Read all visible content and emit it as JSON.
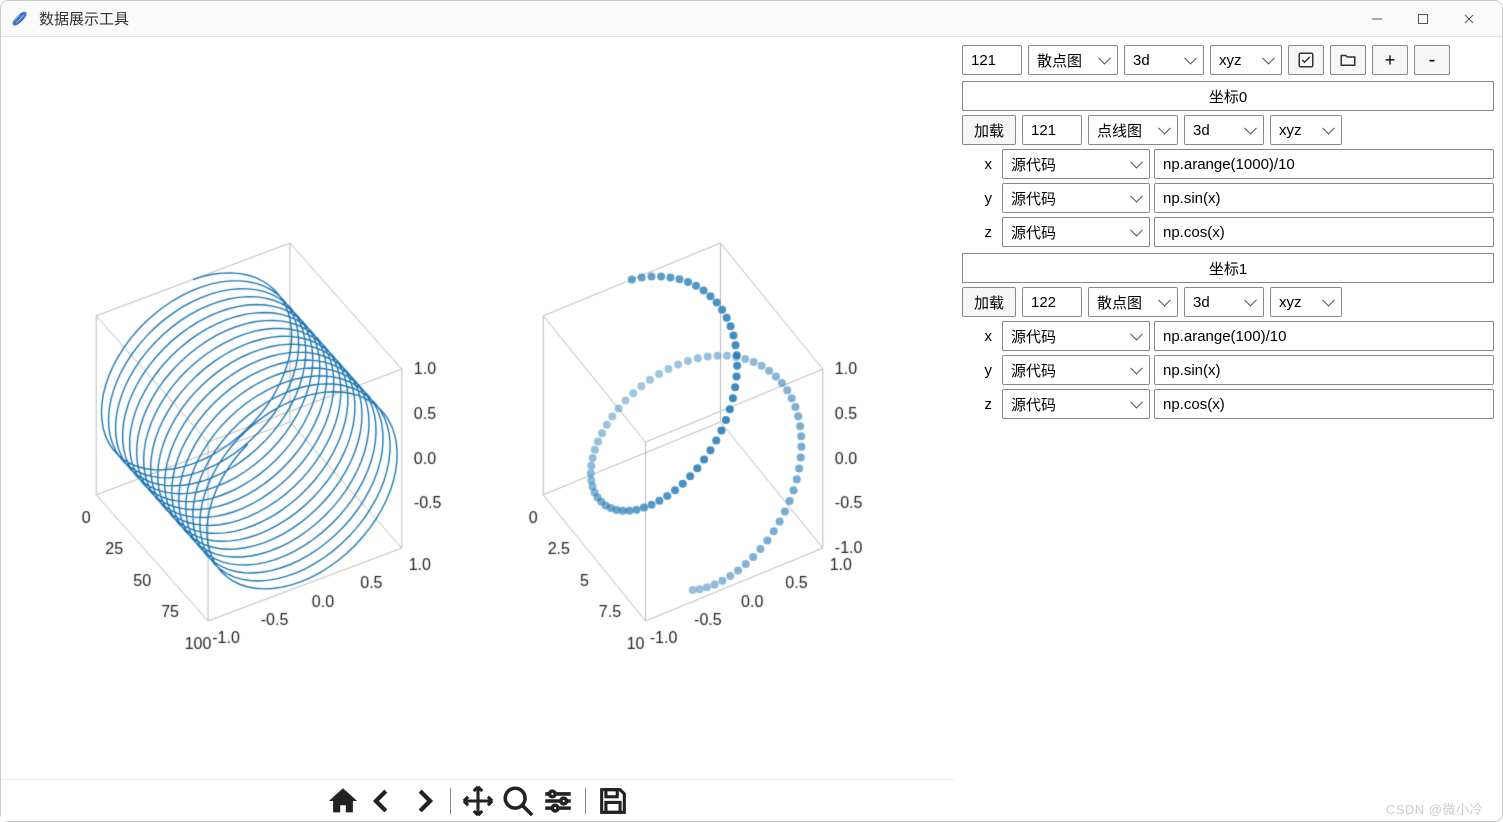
{
  "window": {
    "title": "数据展示工具"
  },
  "toolbar_top": {
    "subplot_code": "121",
    "plot_type": "散点图",
    "dim": "3d",
    "axes": "xyz",
    "plus": "+",
    "minus": "-"
  },
  "sections": [
    {
      "header": "坐标0",
      "load_label": "加载",
      "subplot_code": "121",
      "plot_type": "点线图",
      "dim": "3d",
      "axes": "xyz",
      "rows": [
        {
          "axis": "x",
          "source": "源代码",
          "expr": "np.arange(1000)/10"
        },
        {
          "axis": "y",
          "source": "源代码",
          "expr": "np.sin(x)"
        },
        {
          "axis": "z",
          "source": "源代码",
          "expr": "np.cos(x)"
        }
      ]
    },
    {
      "header": "坐标1",
      "load_label": "加载",
      "subplot_code": "122",
      "plot_type": "散点图",
      "dim": "3d",
      "axes": "xyz",
      "rows": [
        {
          "axis": "x",
          "source": "源代码",
          "expr": "np.arange(100)/10"
        },
        {
          "axis": "y",
          "source": "源代码",
          "expr": "np.sin(x)"
        },
        {
          "axis": "z",
          "source": "源代码",
          "expr": "np.cos(x)"
        }
      ]
    }
  ],
  "chart_data": [
    {
      "type": "3d-line",
      "subplot": 121,
      "x_expr": "np.arange(1000)/10",
      "y_expr": "np.sin(x)",
      "z_expr": "np.cos(x)",
      "x_range": [
        0,
        100
      ],
      "x_ticks": [
        0,
        25,
        50,
        75,
        100
      ],
      "y_range": [
        -1.0,
        1.0
      ],
      "y_ticks": [
        -1.0,
        -0.5,
        0.0,
        0.5,
        1.0
      ],
      "z_range": [
        -1.0,
        1.0
      ],
      "z_ticks": [
        -0.5,
        0.0,
        0.5,
        1.0
      ],
      "color": "#1f77b4"
    },
    {
      "type": "3d-scatter",
      "subplot": 122,
      "x_expr": "np.arange(100)/10",
      "y_expr": "np.sin(x)",
      "z_expr": "np.cos(x)",
      "x_range": [
        0,
        10
      ],
      "x_ticks": [
        0.0,
        2.5,
        5.0,
        7.5,
        10.0
      ],
      "y_range": [
        -1.0,
        1.0
      ],
      "y_ticks": [
        -1.0,
        -0.5,
        0.0,
        0.5,
        1.0
      ],
      "z_range": [
        -1.0,
        1.0
      ],
      "z_ticks": [
        -1.0,
        -0.5,
        0.0,
        0.5,
        1.0
      ],
      "color": "#1f77b4"
    }
  ],
  "watermark": "CSDN @微小冷"
}
